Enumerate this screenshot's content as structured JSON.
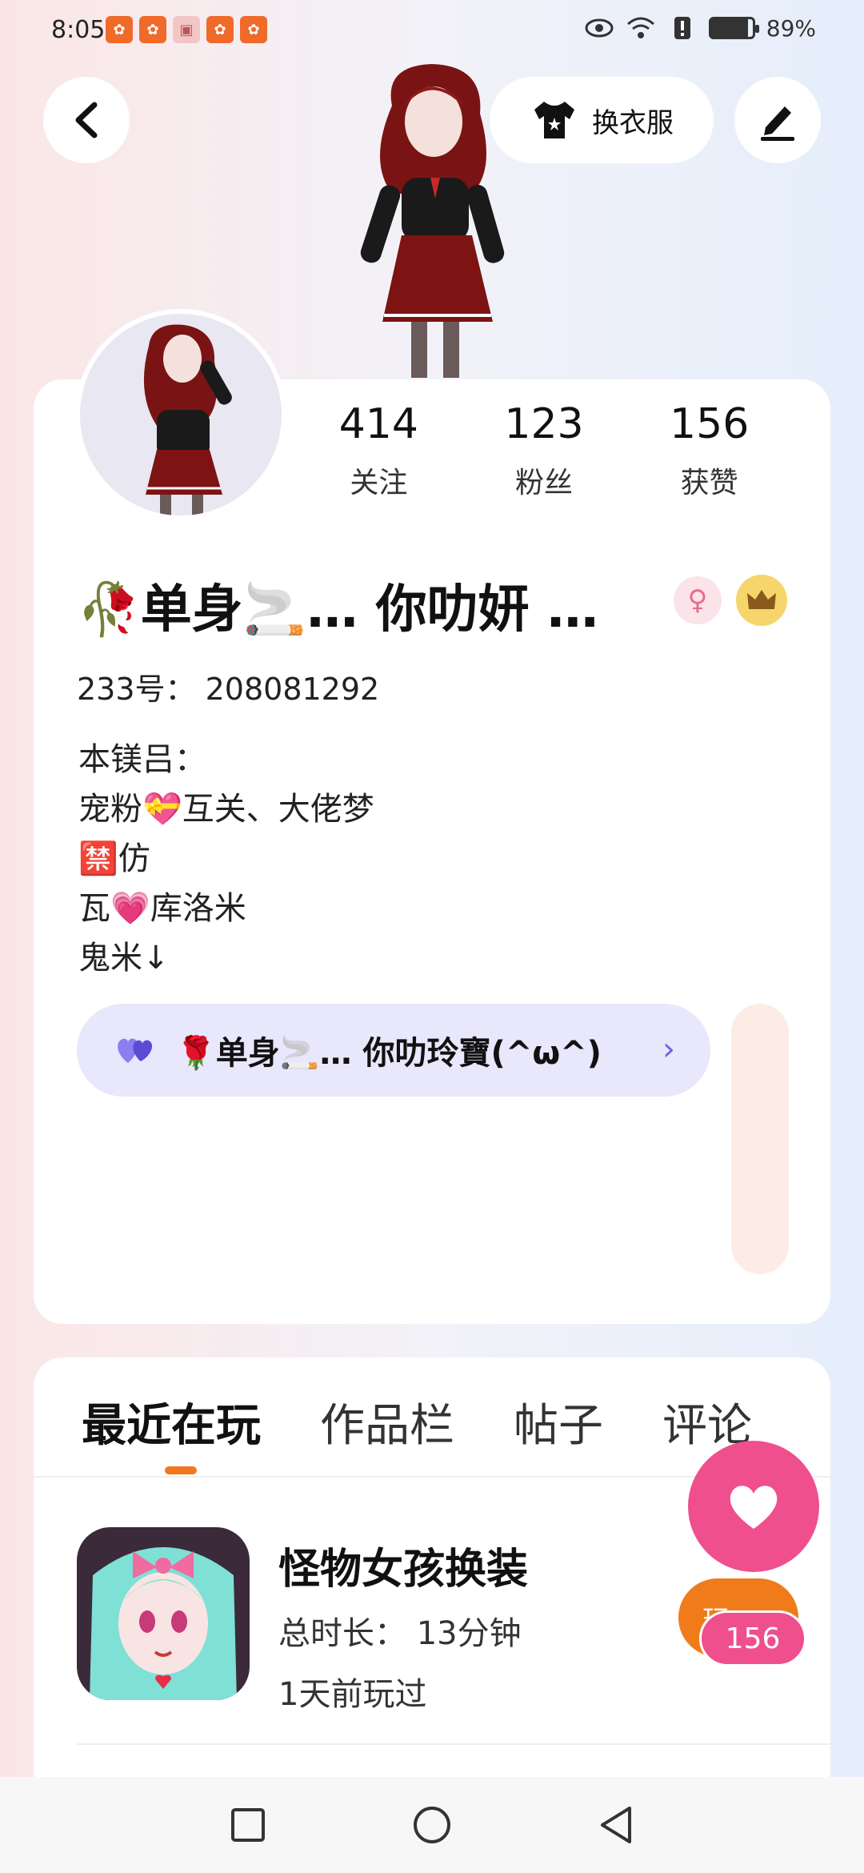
{
  "status_bar": {
    "time": "8:05",
    "battery": "89%",
    "battery_level": 0.89
  },
  "header": {
    "dress_label": "换衣服"
  },
  "profile": {
    "stats": [
      {
        "value": "414",
        "label": "关注"
      },
      {
        "value": "123",
        "label": "粉丝"
      },
      {
        "value": "156",
        "label": "获赞"
      }
    ],
    "nickname": "🥀单身🚬… 你叻妍 …",
    "uid": "233号： 208081292",
    "bio": "本镁吕：\n宠粉💝互关、大佬梦\n🈲仿\n瓦💗库洛米\n鬼米↓",
    "link_chip": "🌹单身🚬… 你叻玲寶(^ω^)"
  },
  "tabs": [
    {
      "label": "最近在玩",
      "active": true
    },
    {
      "label": "作品栏",
      "active": false
    },
    {
      "label": "帖子",
      "active": false
    },
    {
      "label": "评论",
      "active": false
    }
  ],
  "recent_games": [
    {
      "title": "怪物女孩换装",
      "duration": "总时长： 13分钟",
      "last_played": "1天前玩过",
      "play_label": "玩"
    }
  ],
  "like": {
    "count": "156"
  },
  "colors": {
    "accent_orange": "#f07b1a",
    "like_pink": "#ef4f8d",
    "chip_bg": "#e8e7fb",
    "chip_chevron": "#7163dd"
  },
  "icons": [
    "back-arrow-icon",
    "tshirt-icon",
    "edit-pen-icon",
    "female-icon",
    "crown-icon",
    "heart-icon",
    "square-nav-icon",
    "circle-nav-icon",
    "triangle-back-nav-icon"
  ]
}
